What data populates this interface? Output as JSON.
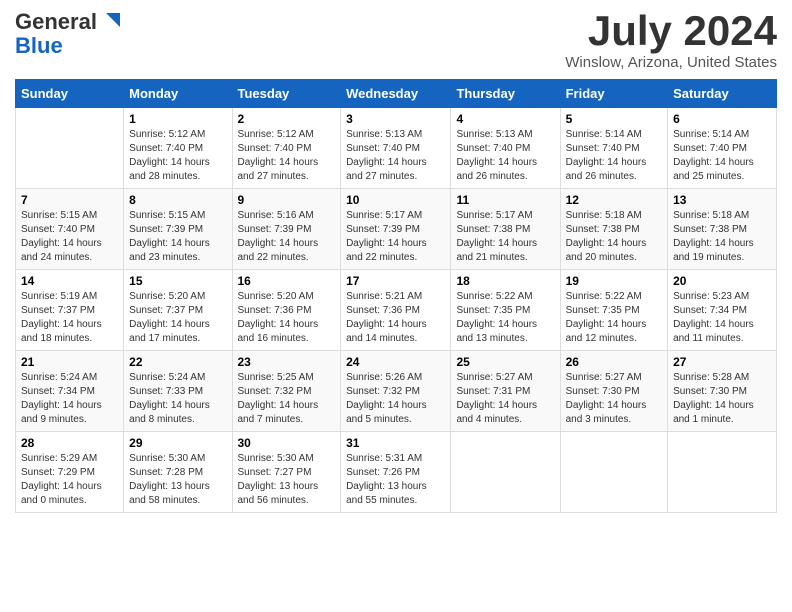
{
  "logo": {
    "general": "General",
    "blue": "Blue"
  },
  "header": {
    "month_year": "July 2024",
    "location": "Winslow, Arizona, United States"
  },
  "days_of_week": [
    "Sunday",
    "Monday",
    "Tuesday",
    "Wednesday",
    "Thursday",
    "Friday",
    "Saturday"
  ],
  "weeks": [
    [
      {
        "day": "",
        "info": ""
      },
      {
        "day": "1",
        "info": "Sunrise: 5:12 AM\nSunset: 7:40 PM\nDaylight: 14 hours\nand 28 minutes."
      },
      {
        "day": "2",
        "info": "Sunrise: 5:12 AM\nSunset: 7:40 PM\nDaylight: 14 hours\nand 27 minutes."
      },
      {
        "day": "3",
        "info": "Sunrise: 5:13 AM\nSunset: 7:40 PM\nDaylight: 14 hours\nand 27 minutes."
      },
      {
        "day": "4",
        "info": "Sunrise: 5:13 AM\nSunset: 7:40 PM\nDaylight: 14 hours\nand 26 minutes."
      },
      {
        "day": "5",
        "info": "Sunrise: 5:14 AM\nSunset: 7:40 PM\nDaylight: 14 hours\nand 26 minutes."
      },
      {
        "day": "6",
        "info": "Sunrise: 5:14 AM\nSunset: 7:40 PM\nDaylight: 14 hours\nand 25 minutes."
      }
    ],
    [
      {
        "day": "7",
        "info": "Sunrise: 5:15 AM\nSunset: 7:40 PM\nDaylight: 14 hours\nand 24 minutes."
      },
      {
        "day": "8",
        "info": "Sunrise: 5:15 AM\nSunset: 7:39 PM\nDaylight: 14 hours\nand 23 minutes."
      },
      {
        "day": "9",
        "info": "Sunrise: 5:16 AM\nSunset: 7:39 PM\nDaylight: 14 hours\nand 22 minutes."
      },
      {
        "day": "10",
        "info": "Sunrise: 5:17 AM\nSunset: 7:39 PM\nDaylight: 14 hours\nand 22 minutes."
      },
      {
        "day": "11",
        "info": "Sunrise: 5:17 AM\nSunset: 7:38 PM\nDaylight: 14 hours\nand 21 minutes."
      },
      {
        "day": "12",
        "info": "Sunrise: 5:18 AM\nSunset: 7:38 PM\nDaylight: 14 hours\nand 20 minutes."
      },
      {
        "day": "13",
        "info": "Sunrise: 5:18 AM\nSunset: 7:38 PM\nDaylight: 14 hours\nand 19 minutes."
      }
    ],
    [
      {
        "day": "14",
        "info": "Sunrise: 5:19 AM\nSunset: 7:37 PM\nDaylight: 14 hours\nand 18 minutes."
      },
      {
        "day": "15",
        "info": "Sunrise: 5:20 AM\nSunset: 7:37 PM\nDaylight: 14 hours\nand 17 minutes."
      },
      {
        "day": "16",
        "info": "Sunrise: 5:20 AM\nSunset: 7:36 PM\nDaylight: 14 hours\nand 16 minutes."
      },
      {
        "day": "17",
        "info": "Sunrise: 5:21 AM\nSunset: 7:36 PM\nDaylight: 14 hours\nand 14 minutes."
      },
      {
        "day": "18",
        "info": "Sunrise: 5:22 AM\nSunset: 7:35 PM\nDaylight: 14 hours\nand 13 minutes."
      },
      {
        "day": "19",
        "info": "Sunrise: 5:22 AM\nSunset: 7:35 PM\nDaylight: 14 hours\nand 12 minutes."
      },
      {
        "day": "20",
        "info": "Sunrise: 5:23 AM\nSunset: 7:34 PM\nDaylight: 14 hours\nand 11 minutes."
      }
    ],
    [
      {
        "day": "21",
        "info": "Sunrise: 5:24 AM\nSunset: 7:34 PM\nDaylight: 14 hours\nand 9 minutes."
      },
      {
        "day": "22",
        "info": "Sunrise: 5:24 AM\nSunset: 7:33 PM\nDaylight: 14 hours\nand 8 minutes."
      },
      {
        "day": "23",
        "info": "Sunrise: 5:25 AM\nSunset: 7:32 PM\nDaylight: 14 hours\nand 7 minutes."
      },
      {
        "day": "24",
        "info": "Sunrise: 5:26 AM\nSunset: 7:32 PM\nDaylight: 14 hours\nand 5 minutes."
      },
      {
        "day": "25",
        "info": "Sunrise: 5:27 AM\nSunset: 7:31 PM\nDaylight: 14 hours\nand 4 minutes."
      },
      {
        "day": "26",
        "info": "Sunrise: 5:27 AM\nSunset: 7:30 PM\nDaylight: 14 hours\nand 3 minutes."
      },
      {
        "day": "27",
        "info": "Sunrise: 5:28 AM\nSunset: 7:30 PM\nDaylight: 14 hours\nand 1 minute."
      }
    ],
    [
      {
        "day": "28",
        "info": "Sunrise: 5:29 AM\nSunset: 7:29 PM\nDaylight: 14 hours\nand 0 minutes."
      },
      {
        "day": "29",
        "info": "Sunrise: 5:30 AM\nSunset: 7:28 PM\nDaylight: 13 hours\nand 58 minutes."
      },
      {
        "day": "30",
        "info": "Sunrise: 5:30 AM\nSunset: 7:27 PM\nDaylight: 13 hours\nand 56 minutes."
      },
      {
        "day": "31",
        "info": "Sunrise: 5:31 AM\nSunset: 7:26 PM\nDaylight: 13 hours\nand 55 minutes."
      },
      {
        "day": "",
        "info": ""
      },
      {
        "day": "",
        "info": ""
      },
      {
        "day": "",
        "info": ""
      }
    ]
  ]
}
